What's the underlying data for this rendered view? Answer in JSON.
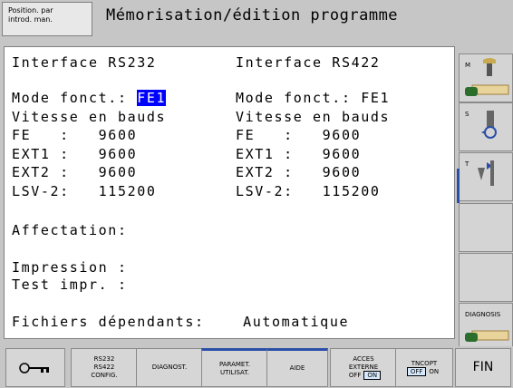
{
  "header": {
    "mode_line1": "Position. par",
    "mode_line2": "introd. man.",
    "title": "Mémorisation/édition programme"
  },
  "left": {
    "heading": "Interface RS232",
    "mode_label": "Mode fonct.: ",
    "mode_value": "FE1",
    "speed_label": "Vitesse en bauds",
    "fe": "FE   :   9600",
    "ext1": "EXT1 :   9600",
    "ext2": "EXT2 :   9600",
    "lsv": "LSV-2:   115200"
  },
  "right": {
    "heading": "Interface RS422",
    "mode": "Mode fonct.: FE1",
    "speed_label": "Vitesse en bauds",
    "fe": "FE   :   9600",
    "ext1": "EXT1 :   9600",
    "ext2": "EXT2 :   9600",
    "lsv": "LSV-2:   115200"
  },
  "assignment": {
    "label": "Affectation:",
    "print": "Impression :",
    "test_print": "Test impr. :",
    "dependent_files": "Fichiers dépendants:    Automatique"
  },
  "side": {
    "m": "M",
    "s": "S",
    "t": "T",
    "diag": "DIAGNOSIS"
  },
  "softkeys": {
    "rs_l1": "RS232",
    "rs_l2": "RS422",
    "rs_l3": "CONFIG.",
    "diagnost": "DIAGNOST.",
    "param_l1": "PARAMET.",
    "param_l2": "UTILISAT.",
    "aide": "AIDE",
    "acces_l1": "ACCES",
    "acces_l2": "EXTERNE",
    "off": "OFF",
    "on": "ON",
    "tncopt": "TNCOPT",
    "fin": "FIN"
  }
}
